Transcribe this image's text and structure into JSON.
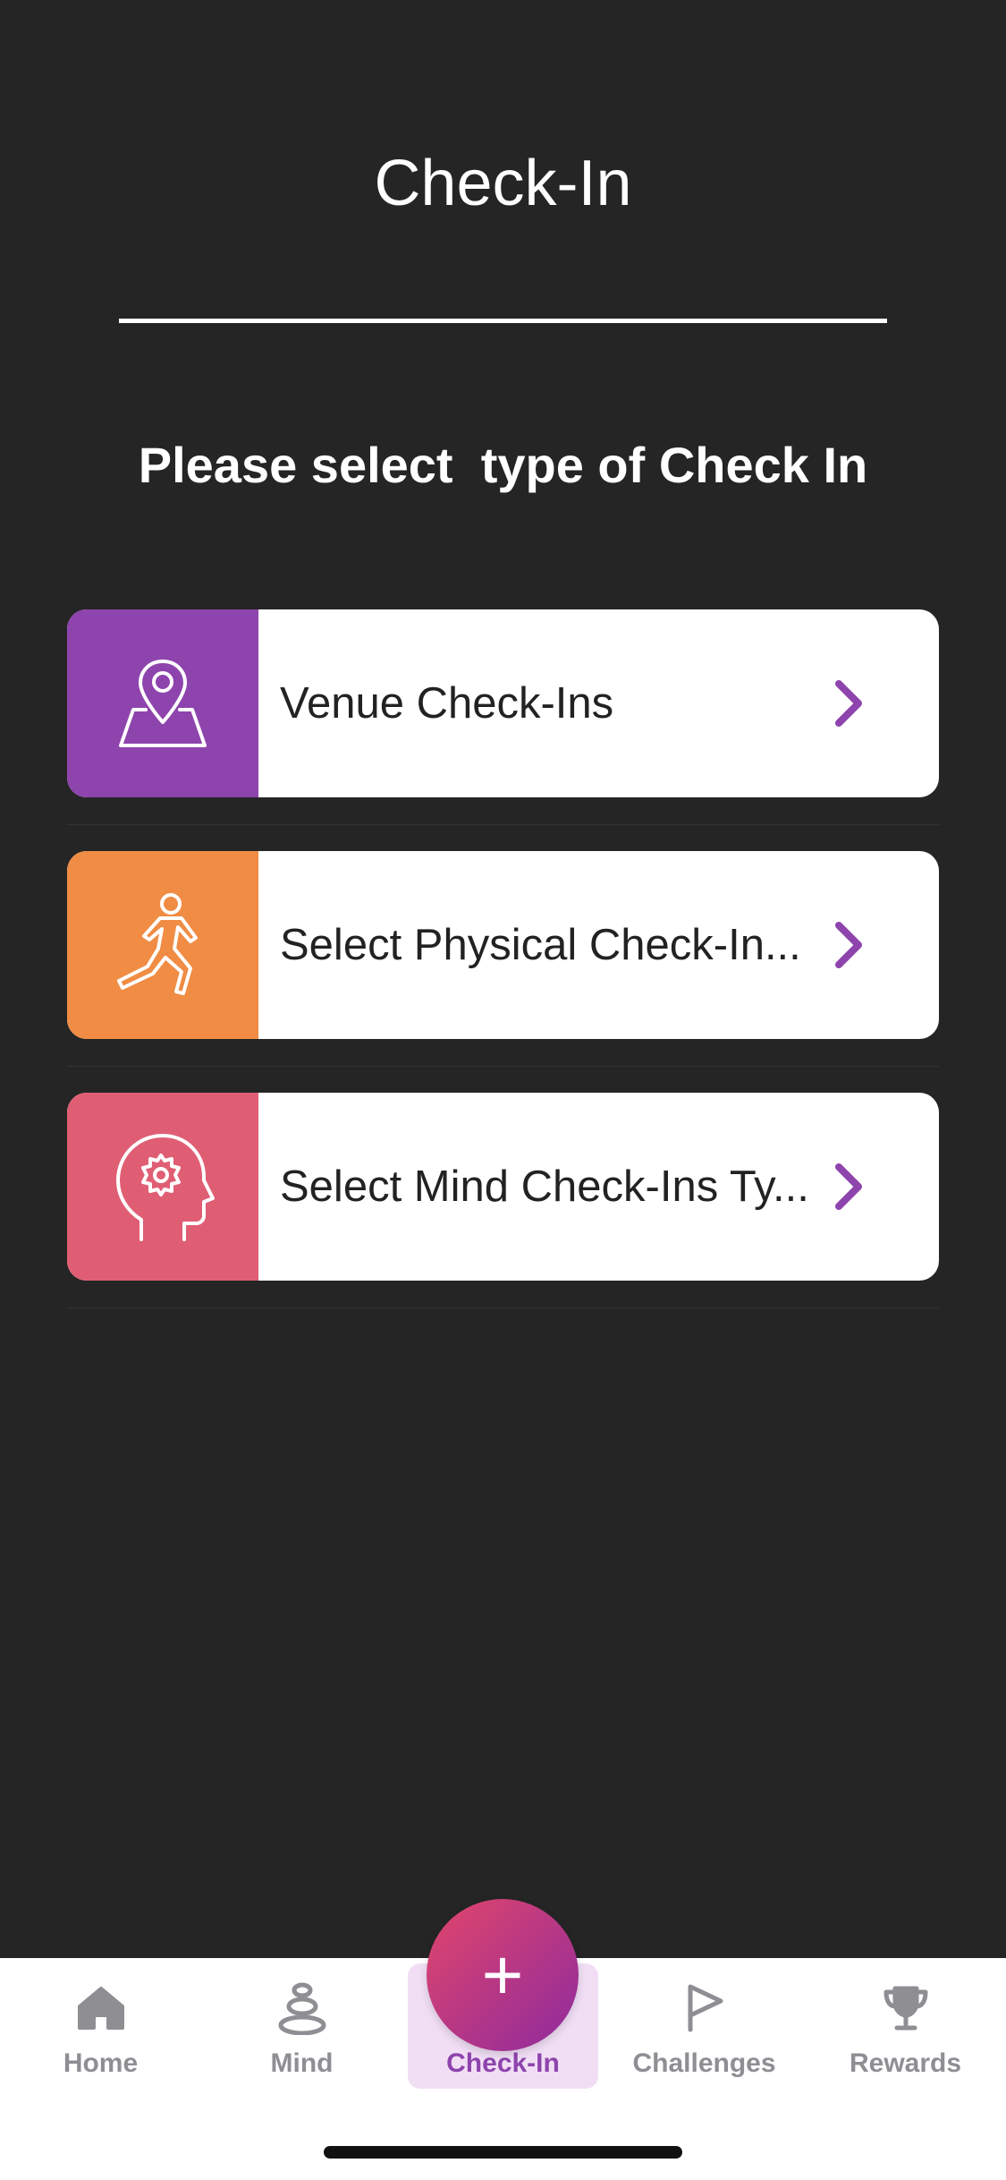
{
  "header": {
    "title": "Check-In"
  },
  "prompt": "Please select  type of Check In",
  "options": [
    {
      "label": "Venue Check-Ins",
      "color": "#8e44ad",
      "icon": "map-pin-icon"
    },
    {
      "label": "Select Physical Check-In...",
      "color": "#f08c44",
      "icon": "exercise-icon"
    },
    {
      "label": "Select Mind Check-Ins Ty...",
      "color": "#e05e74",
      "icon": "mind-gear-icon"
    }
  ],
  "accent_color": "#8e44ad",
  "tabs": [
    {
      "label": "Home",
      "icon": "home-icon"
    },
    {
      "label": "Mind",
      "icon": "stones-icon"
    },
    {
      "label": "Check-In",
      "icon": "plus-icon",
      "active": true
    },
    {
      "label": "Challenges",
      "icon": "flag-icon"
    },
    {
      "label": "Rewards",
      "icon": "trophy-icon"
    }
  ],
  "fab": {
    "symbol": "+"
  }
}
